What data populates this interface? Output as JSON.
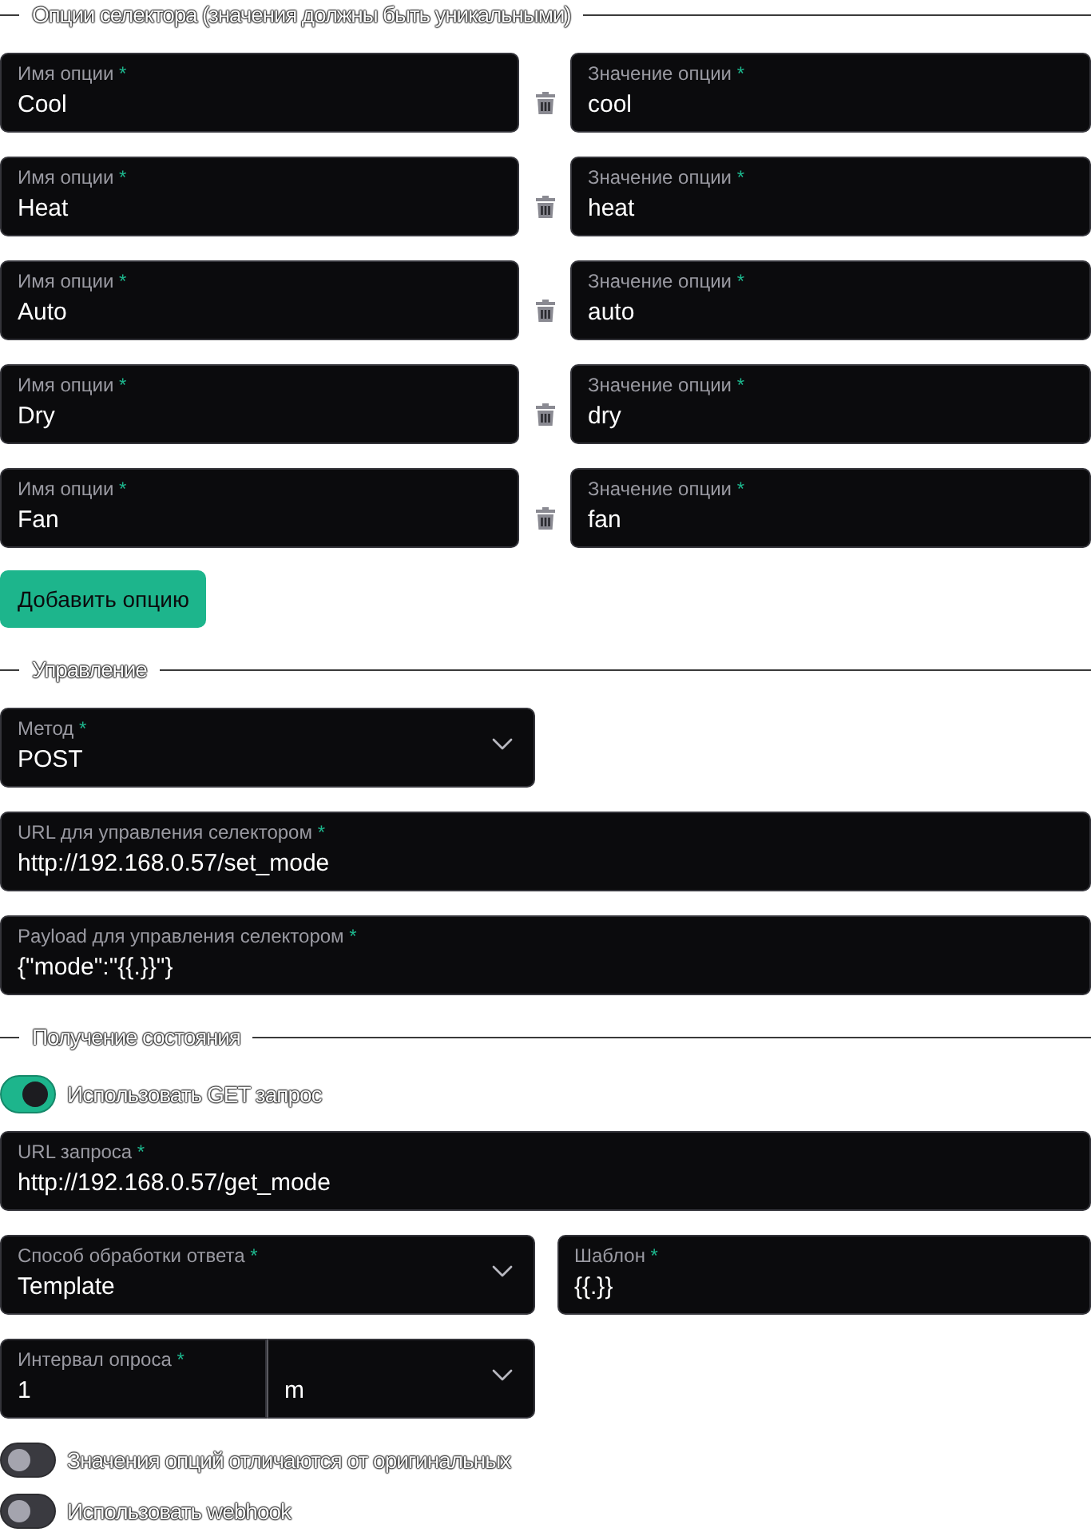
{
  "options_section": {
    "title": "Опции селектора (значения должны быть уникальными)",
    "options": [
      {
        "name": {
          "label": "Имя опции",
          "mark": "*",
          "value": "Cool"
        },
        "value": {
          "label": "Значение опции",
          "mark": "*",
          "value": "cool"
        }
      },
      {
        "name": {
          "label": "Имя опции",
          "mark": "*",
          "value": "Heat"
        },
        "value": {
          "label": "Значение опции",
          "mark": "*",
          "value": "heat"
        }
      },
      {
        "name": {
          "label": "Имя опции",
          "mark": "*",
          "value": "Auto"
        },
        "value": {
          "label": "Значение опции",
          "mark": "*",
          "value": "auto"
        }
      },
      {
        "name": {
          "label": "Имя опции",
          "mark": "*",
          "value": "Dry"
        },
        "value": {
          "label": "Значение опции",
          "mark": "*",
          "value": "dry"
        }
      },
      {
        "name": {
          "label": "Имя опции",
          "mark": "*",
          "value": "Fan"
        },
        "value": {
          "label": "Значение опции",
          "mark": "*",
          "value": "fan"
        }
      }
    ],
    "add_button": "Добавить опцию"
  },
  "control_section": {
    "title": "Управление",
    "method": {
      "label": "Метод",
      "mark": "*",
      "value": "POST"
    },
    "url": {
      "label": "URL для управления селектором",
      "mark": "*",
      "value": "http://192.168.0.57/set_mode"
    },
    "payload": {
      "label": "Payload для управления селектором",
      "mark": "*",
      "value": "{\"mode\":\"{{.}}\"}"
    }
  },
  "state_section": {
    "title": "Получение состояния",
    "use_get": {
      "label": "Использовать GET запрос",
      "on": true
    },
    "request_url": {
      "label": "URL запроса",
      "mark": "*",
      "value": "http://192.168.0.57/get_mode"
    },
    "response_mode": {
      "label": "Способ обработки ответа",
      "mark": "*",
      "value": "Template"
    },
    "template": {
      "label": "Шаблон",
      "mark": "*",
      "value": "{{.}}"
    },
    "interval": {
      "label": "Интервал опроса",
      "mark": "*",
      "value": "1",
      "unit": "m"
    },
    "toggles": [
      {
        "label": "Значения опций отличаются от оригинальных",
        "on": false
      },
      {
        "label": "Использовать webhook",
        "on": false
      }
    ]
  }
}
